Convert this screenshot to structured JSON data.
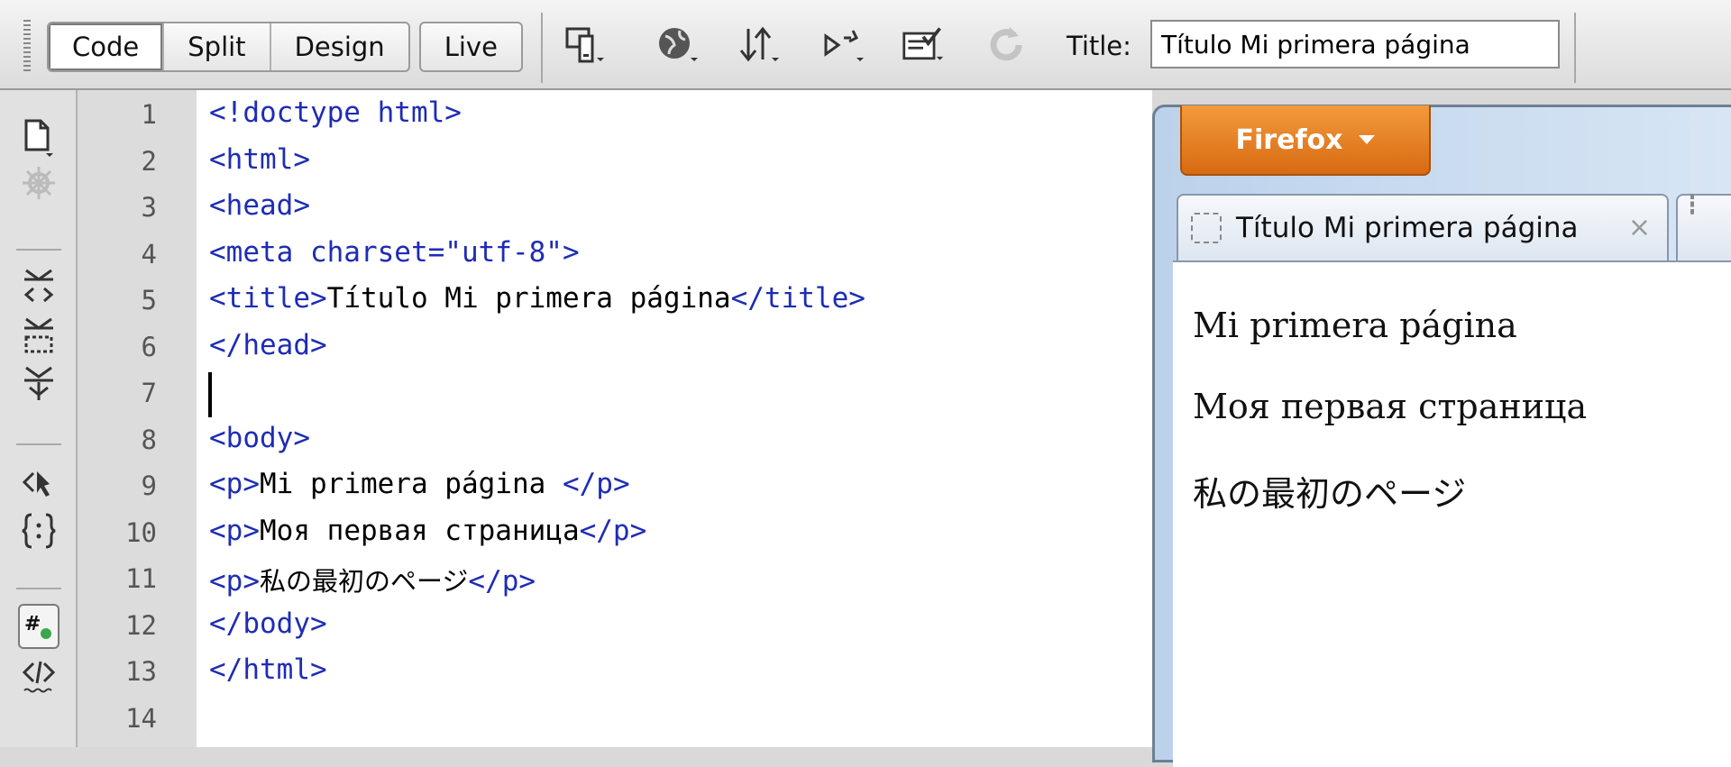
{
  "toolbar": {
    "view_buttons": [
      "Code",
      "Split",
      "Design",
      "Live"
    ],
    "title_label": "Title:",
    "title_value": "Título Mi primera página",
    "icons": [
      "multiscreen-icon",
      "browser-preview-icon",
      "file-management-icon",
      "visual-aids-icon",
      "check-page-icon",
      "refresh-icon"
    ]
  },
  "left_tools": [
    "open-documents-icon",
    "show-code-navigator-icon",
    "collapse-tag-icon",
    "collapse-selection-icon",
    "expand-all-icon",
    "select-parent-tag-icon",
    "balance-braces-icon",
    "line-numbers-icon",
    "highlight-invalid-code-icon"
  ],
  "editor": {
    "line_numbers": [
      "1",
      "2",
      "3",
      "4",
      "5",
      "6",
      "7",
      "8",
      "9",
      "10",
      "11",
      "12",
      "13",
      "14"
    ],
    "lines": {
      "l1": "<!doctype html>",
      "l2": "<html>",
      "l3": "<head>",
      "l4a": "<meta charset=",
      "l4b": "\"utf-8\"",
      "l4c": ">",
      "l5a": "<title>",
      "l5b": "Título Mi primera página",
      "l5c": "</title>",
      "l6": "</head>",
      "l8": "<body>",
      "l9a": "<p>",
      "l9b": "Mi primera página ",
      "l9c": "</p>",
      "l10a": "<p>",
      "l10b": "Моя первая страница",
      "l10c": "</p>",
      "l11a": "<p>",
      "l11b": "私の最初のページ",
      "l11c": "</p>",
      "l12": "</body>",
      "l13": "</html>"
    },
    "colors": {
      "tag": "#1e2cb4",
      "text": "#000000"
    }
  },
  "browser": {
    "menu_button": "Firefox",
    "tab_title": "Título Mi primera página",
    "tab_close": "×",
    "paragraphs": [
      "Mi primera página",
      "Моя первая страница",
      "私の最初のページ"
    ]
  }
}
